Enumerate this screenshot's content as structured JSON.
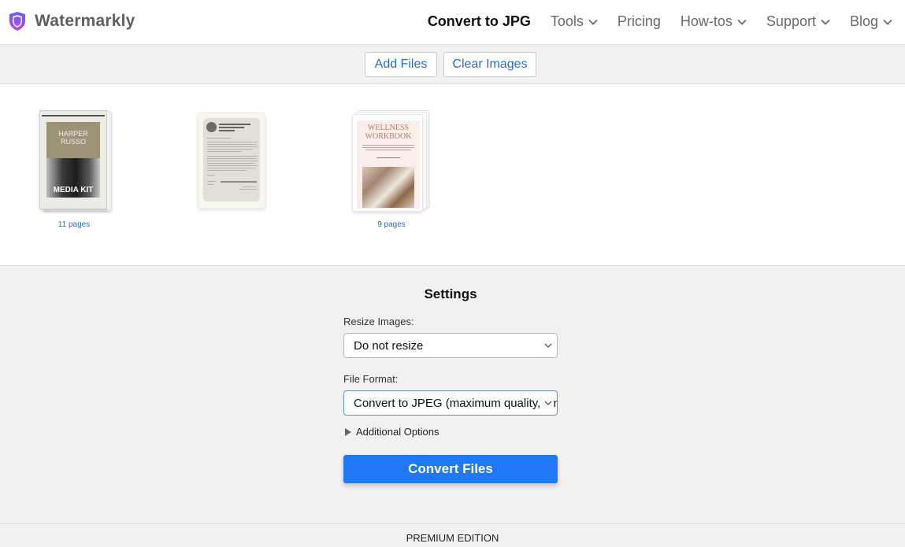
{
  "header": {
    "brand": "Watermarkly",
    "brand_colors": {
      "top": "#6a5cf5",
      "bottom": "#b54bea"
    },
    "nav": [
      {
        "label": "Convert to JPG",
        "active": true,
        "dropdown": false
      },
      {
        "label": "Tools",
        "dropdown": true
      },
      {
        "label": "Pricing",
        "dropdown": false
      },
      {
        "label": "How-tos",
        "dropdown": true
      },
      {
        "label": "Support",
        "dropdown": true
      },
      {
        "label": "Blog",
        "dropdown": true
      }
    ]
  },
  "toolbar": {
    "add_files": "Add Files",
    "clear_images": "Clear Images"
  },
  "files": [
    {
      "name": "media-kit",
      "title_line1": "HARPER",
      "title_line2": "RUSSO",
      "overlay": "MEDIA KIT",
      "caption": "11 pages"
    },
    {
      "name": "letter",
      "caption": ""
    },
    {
      "name": "wellness-workbook",
      "title_line1": "WELLNESS",
      "title_line2": "WORKBOOK",
      "caption": "9 pages"
    }
  ],
  "settings": {
    "title": "Settings",
    "resize_label": "Resize Images:",
    "resize_value": "Do not resize",
    "format_label": "File Format:",
    "format_value": "Convert to JPEG (maximum quality, smallest size)",
    "additional_options": "Additional Options",
    "convert_button": "Convert Files"
  },
  "footer": {
    "edition": "PREMIUM EDITION"
  },
  "colors": {
    "accent": "#1f78f5",
    "link": "#1f6fd1"
  }
}
